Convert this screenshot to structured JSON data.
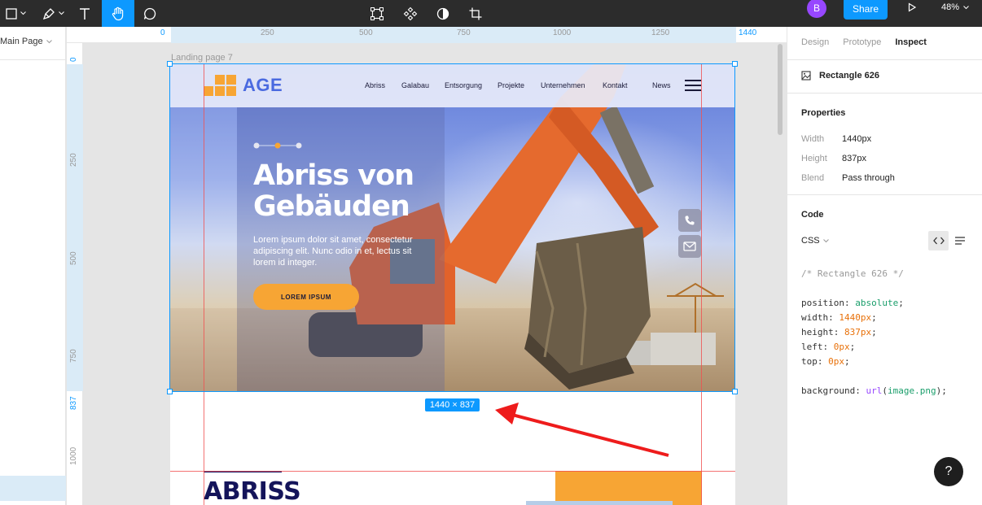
{
  "toolbar": {
    "tools": [
      {
        "name": "frame-tool"
      },
      {
        "name": "pen-tool"
      },
      {
        "name": "text-tool"
      },
      {
        "name": "hand-tool"
      },
      {
        "name": "comment-tool"
      }
    ],
    "center_tools": [
      "frame-select-icon",
      "component-icon",
      "contrast-icon",
      "crop-icon"
    ],
    "avatar_initial": "B",
    "share_label": "Share",
    "zoom_label": "48%",
    "accent_color": "#0d99ff"
  },
  "left_panel": {
    "page_label": "Main Page"
  },
  "rulers": {
    "top_ticks": [
      "0",
      "250",
      "500",
      "750",
      "1000",
      "1250",
      "1440"
    ],
    "left_ticks": [
      "0",
      "250",
      "500",
      "750",
      "837",
      "1000"
    ]
  },
  "canvas": {
    "frame_label": "Landing page 7",
    "size_tag": "1440 × 837",
    "site": {
      "logo_text": "AGE",
      "nav": [
        "Abriss",
        "Galabau",
        "Entsorgung",
        "Projekte",
        "Unternehmen",
        "Kontakt",
        "News"
      ],
      "hero_title_line1": "Abriss von",
      "hero_title_line2": "Gebäuden",
      "hero_text": "Lorem ipsum dolor sit amet, consectetur adipiscing elit. Nunc odio in et, lectus sit lorem id integer.",
      "hero_button": "LOREM IPSUM",
      "section_title": "ABRISS",
      "brand_orange": "#f7a534",
      "brand_blue": "#4a6ae0"
    }
  },
  "inspect": {
    "tabs": [
      "Design",
      "Prototype",
      "Inspect"
    ],
    "active_tab": "Inspect",
    "layer_name": "Rectangle 626",
    "properties_heading": "Properties",
    "props": [
      {
        "label": "Width",
        "value": "1440px"
      },
      {
        "label": "Height",
        "value": "837px"
      },
      {
        "label": "Blend",
        "value": "Pass through"
      }
    ],
    "code_heading": "Code",
    "code_lang": "CSS",
    "code": {
      "comment": "/* Rectangle 626 */",
      "position_key": "position: ",
      "position_val": "absolute",
      "width_key": "width: ",
      "width_val": "1440px",
      "height_key": "height: ",
      "height_val": "837px",
      "left_key": "left: ",
      "left_val": "0px",
      "top_key": "top: ",
      "top_val": "0px",
      "background_key": "background: ",
      "background_fn": "url",
      "background_arg": "image.png"
    }
  },
  "help_label": "?"
}
